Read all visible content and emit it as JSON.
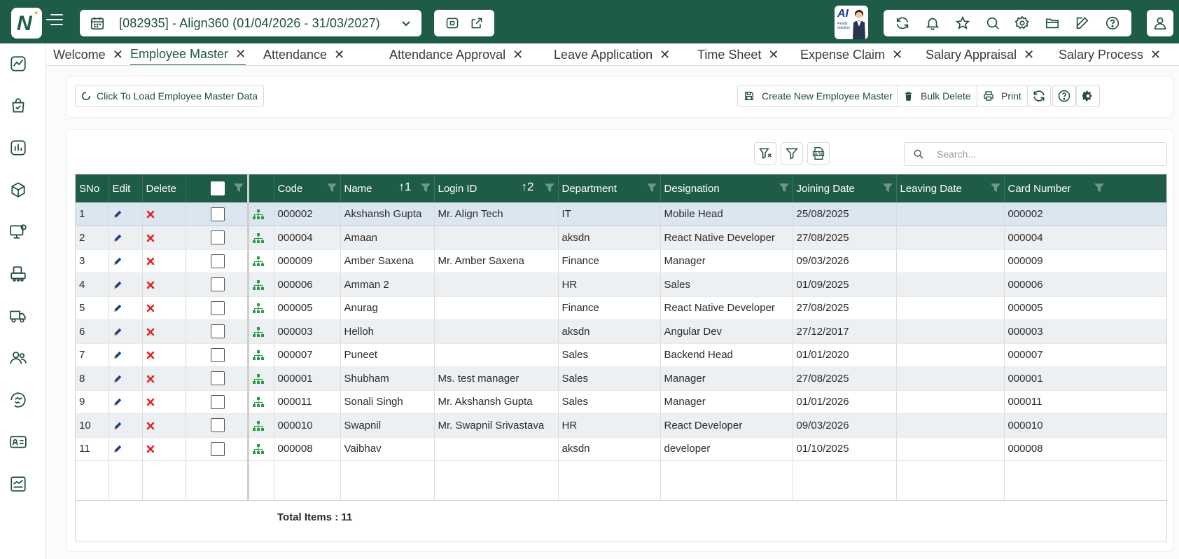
{
  "header": {
    "company": "[082935] - Align360 (01/04/2026 - 31/03/2027)",
    "ai_badge": {
      "title": "AI",
      "subtitle": "Ready Solution"
    }
  },
  "tabs": [
    {
      "label": "Welcome",
      "active": false
    },
    {
      "label": "Employee Master",
      "active": true
    },
    {
      "label": "Attendance",
      "active": false
    },
    {
      "label": "Attendance Approval",
      "active": false
    },
    {
      "label": "Leave Application",
      "active": false
    },
    {
      "label": "Time Sheet",
      "active": false
    },
    {
      "label": "Expense Claim",
      "active": false
    },
    {
      "label": "Salary Appraisal",
      "active": false
    },
    {
      "label": "Salary Process",
      "active": false
    }
  ],
  "toolbar": {
    "load_label": "Click To Load Employee Master Data",
    "create_label": "Create New Employee Master",
    "bulk_delete_label": "Bulk Delete",
    "print_label": "Print"
  },
  "search": {
    "placeholder": "Search..."
  },
  "table": {
    "columns": {
      "sno": "SNo",
      "edit": "Edit",
      "delete": "Delete",
      "code": "Code",
      "name": "Name",
      "login_id": "Login ID",
      "department": "Department",
      "designation": "Designation",
      "joining_date": "Joining Date",
      "leaving_date": "Leaving Date",
      "card_number": "Card Number"
    },
    "sort_markers": {
      "name": "1",
      "login_id": "2"
    },
    "rows": [
      {
        "sno": "1",
        "code": "000002",
        "name": "Akshansh Gupta",
        "login_id": "Mr. Align Tech",
        "department": "IT",
        "designation": "Mobile Head",
        "joining_date": "25/08/2025",
        "leaving_date": "",
        "card_number": "000002"
      },
      {
        "sno": "2",
        "code": "000004",
        "name": "Amaan",
        "login_id": "",
        "department": "aksdn",
        "designation": "React Native Developer",
        "joining_date": "27/08/2025",
        "leaving_date": "",
        "card_number": "000004"
      },
      {
        "sno": "3",
        "code": "000009",
        "name": "Amber Saxena",
        "login_id": "Mr. Amber Saxena",
        "department": "Finance",
        "designation": "Manager",
        "joining_date": "09/03/2026",
        "leaving_date": "",
        "card_number": "000009"
      },
      {
        "sno": "4",
        "code": "000006",
        "name": "Amman 2",
        "login_id": "",
        "department": "HR",
        "designation": "Sales",
        "joining_date": "01/09/2025",
        "leaving_date": "",
        "card_number": "000006"
      },
      {
        "sno": "5",
        "code": "000005",
        "name": "Anurag",
        "login_id": "",
        "department": "Finance",
        "designation": "React Native Developer",
        "joining_date": "27/08/2025",
        "leaving_date": "",
        "card_number": "000005"
      },
      {
        "sno": "6",
        "code": "000003",
        "name": "Helloh",
        "login_id": "",
        "department": "aksdn",
        "designation": "Angular Dev",
        "joining_date": "27/12/2017",
        "leaving_date": "",
        "card_number": "000003"
      },
      {
        "sno": "7",
        "code": "000007",
        "name": "Puneet",
        "login_id": "",
        "department": "Sales",
        "designation": "Backend Head",
        "joining_date": "01/01/2020",
        "leaving_date": "",
        "card_number": "000007"
      },
      {
        "sno": "8",
        "code": "000001",
        "name": "Shubham",
        "login_id": "Ms. test manager",
        "department": "Sales",
        "designation": "Manager",
        "joining_date": "27/08/2025",
        "leaving_date": "",
        "card_number": "000001"
      },
      {
        "sno": "9",
        "code": "000011",
        "name": "Sonali Singh",
        "login_id": "Mr. Akshansh Gupta",
        "department": "Sales",
        "designation": "Manager",
        "joining_date": "01/01/2026",
        "leaving_date": "",
        "card_number": "000011"
      },
      {
        "sno": "10",
        "code": "000010",
        "name": "Swapnil",
        "login_id": "Mr. Swapnil Srivastava",
        "department": "HR",
        "designation": "React Developer",
        "joining_date": "09/03/2026",
        "leaving_date": "",
        "card_number": "000010"
      },
      {
        "sno": "11",
        "code": "000008",
        "name": "Vaibhav",
        "login_id": "",
        "department": "aksdn",
        "designation": "developer",
        "joining_date": "01/10/2025",
        "leaving_date": "",
        "card_number": "000008"
      }
    ],
    "total_label": "Total Items : 11"
  },
  "colors": {
    "brand": "#1f5c47",
    "delete": "#e02424",
    "edit": "#1d3f8f",
    "org": "#2e9a45"
  },
  "icons": {
    "sidebar": [
      "dashboard-chart-icon",
      "shopping-bag-check-icon",
      "bar-chart-icon",
      "cube-icon",
      "monitor-settings-icon",
      "factory-icon",
      "truck-icon",
      "users-icon",
      "handshake-icon",
      "id-card-icon",
      "report-icon"
    ],
    "toolbar": [
      "sync-icon",
      "bell-icon",
      "star-icon",
      "search-icon",
      "gear-icon",
      "folder-icon",
      "edit-icon",
      "help-icon"
    ]
  }
}
